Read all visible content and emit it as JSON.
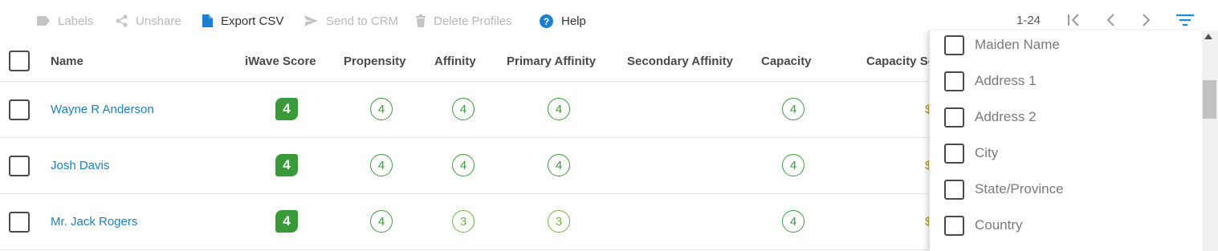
{
  "toolbar": {
    "labels": "Labels",
    "unshare": "Unshare",
    "export_csv": "Export CSV",
    "send_to_crm": "Send to CRM",
    "delete_profiles": "Delete Profiles",
    "help": "Help"
  },
  "pager": {
    "range": "1-24"
  },
  "table": {
    "headers": {
      "name": "Name",
      "iwave_score": "iWave Score",
      "propensity": "Propensity",
      "affinity": "Affinity",
      "primary_affinity": "Primary Affinity",
      "secondary_affinity": "Secondary Affinity",
      "capacity": "Capacity",
      "capacity_score_partial": "Capacity Sc"
    },
    "rows": [
      {
        "name": "Wayne R Anderson",
        "iwave_score": "4",
        "propensity": "4",
        "affinity": "4",
        "primary_affinity": "4",
        "capacity": "4",
        "edge": "$"
      },
      {
        "name": "Josh Davis",
        "iwave_score": "4",
        "propensity": "4",
        "affinity": "4",
        "primary_affinity": "4",
        "capacity": "4",
        "edge": "$"
      },
      {
        "name": "Mr. Jack Rogers",
        "iwave_score": "4",
        "propensity": "4",
        "affinity": "3",
        "primary_affinity": "3",
        "capacity": "4",
        "edge": "$"
      }
    ]
  },
  "column_menu": {
    "items": [
      "Maiden Name",
      "Address 1",
      "Address 2",
      "City",
      "State/Province",
      "Country"
    ]
  },
  "colors": {
    "link": "#1f7fbf",
    "score_green": "#3a9a3a",
    "help_blue": "#1a7fd0",
    "filter_blue": "#1a8fd8"
  },
  "icons": {
    "labels": "label-tag-icon",
    "unshare": "share-icon",
    "export_csv": "file-icon",
    "send_to_crm": "send-icon",
    "delete_profiles": "trash-icon",
    "help": "help-circle-icon",
    "first_page": "first-page-icon",
    "prev_page": "chevron-left-icon",
    "next_page": "chevron-right-icon",
    "column_filter": "filter-lines-icon"
  }
}
